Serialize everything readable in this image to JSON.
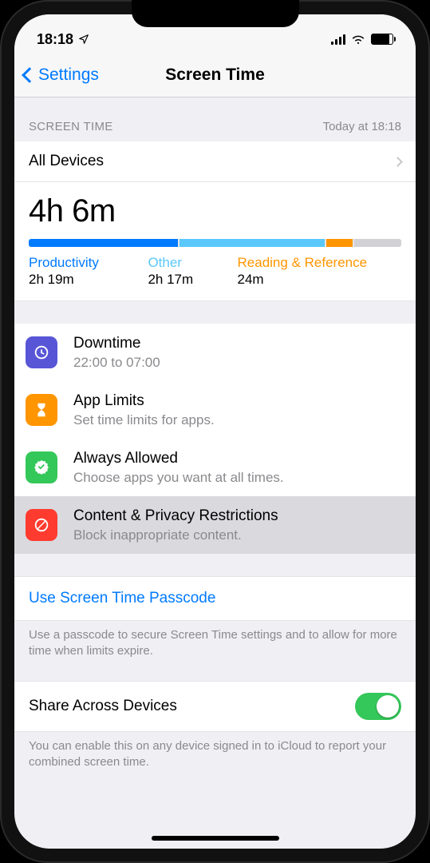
{
  "status": {
    "time": "18:18"
  },
  "nav": {
    "back": "Settings",
    "title": "Screen Time"
  },
  "summary": {
    "header_left": "SCREEN TIME",
    "header_right": "Today at 18:18",
    "devices_label": "All Devices",
    "total": "4h 6m",
    "categories": [
      {
        "label": "Productivity",
        "time": "2h 19m"
      },
      {
        "label": "Other",
        "time": "2h 17m"
      },
      {
        "label": "Reading & Reference",
        "time": "24m"
      }
    ]
  },
  "options": {
    "downtime": {
      "title": "Downtime",
      "sub": "22:00 to 07:00"
    },
    "applimits": {
      "title": "App Limits",
      "sub": "Set time limits for apps."
    },
    "always": {
      "title": "Always Allowed",
      "sub": "Choose apps you want at all times."
    },
    "content": {
      "title": "Content & Privacy Restrictions",
      "sub": "Block inappropriate content."
    }
  },
  "passcode": {
    "link": "Use Screen Time Passcode",
    "footer": "Use a passcode to secure Screen Time settings and to allow for more time when limits expire."
  },
  "share": {
    "label": "Share Across Devices",
    "footer": "You can enable this on any device signed in to iCloud to report your combined screen time."
  }
}
